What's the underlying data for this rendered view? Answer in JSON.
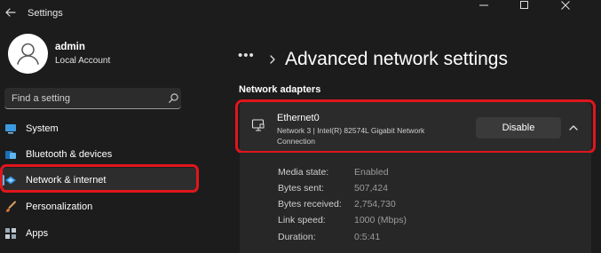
{
  "window": {
    "title": "Settings",
    "back_icon": "back-arrow-icon",
    "controls": [
      "minimize-icon",
      "maximize-icon",
      "close-icon"
    ]
  },
  "user": {
    "name": "admin",
    "account_type": "Local Account"
  },
  "search": {
    "placeholder": "Find a setting",
    "value": ""
  },
  "sidebar": {
    "items": [
      {
        "label": "System",
        "icon": "monitor-icon",
        "active": false
      },
      {
        "label": "Bluetooth & devices",
        "icon": "bluetooth-devices-icon",
        "active": false
      },
      {
        "label": "Network & internet",
        "icon": "wifi-diamond-icon",
        "active": true
      },
      {
        "label": "Personalization",
        "icon": "brush-icon",
        "active": false
      },
      {
        "label": "Apps",
        "icon": "apps-grid-icon",
        "active": false
      }
    ]
  },
  "breadcrumb": {
    "dots": "•••",
    "title": "Advanced network settings"
  },
  "section": {
    "label": "Network adapters"
  },
  "adapter": {
    "name": "Ethernet0",
    "description": "Network 3 | Intel(R) 82574L Gigabit Network Connection",
    "button_label": "Disable",
    "expanded": true,
    "details": [
      {
        "key": "Media state:",
        "value": "Enabled"
      },
      {
        "key": "Bytes sent:",
        "value": "507,424"
      },
      {
        "key": "Bytes received:",
        "value": "2,754,730"
      },
      {
        "key": "Link speed:",
        "value": "1000 (Mbps)"
      },
      {
        "key": "Duration:",
        "value": "0:5:41"
      }
    ]
  },
  "colors": {
    "background": "#1c1c1c",
    "accent": "#4cc2ff",
    "highlight_outline": "#e0161d",
    "card": "#2b2b2b"
  }
}
